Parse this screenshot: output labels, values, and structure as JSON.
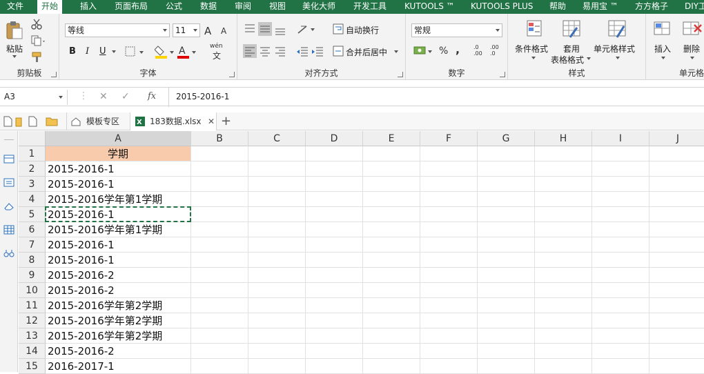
{
  "menu": {
    "tabs": [
      "文件",
      "开始",
      "插入",
      "页面布局",
      "公式",
      "数据",
      "审阅",
      "视图",
      "美化大师",
      "开发工具",
      "KUTOOLS ™",
      "KUTOOLS PLUS",
      "帮助",
      "易用宝 ™",
      "方方格子",
      "DIY工"
    ],
    "active": "开始"
  },
  "ribbon": {
    "clipboard": {
      "label": "剪贴板",
      "paste": "粘贴"
    },
    "font": {
      "label": "字体",
      "name": "等线",
      "size": "11",
      "grow": "A",
      "shrink": "A",
      "bold": "B",
      "italic": "I",
      "underline": "U",
      "wen": "wén",
      "wen_char": "文",
      "font_color_letter": "A"
    },
    "align": {
      "label": "对齐方式",
      "wrap": "自动换行",
      "merge": "合并后居中"
    },
    "number": {
      "label": "数字",
      "format": "常规",
      "percent": "%",
      "comma": ",",
      "inc_dec": ".0\n.00",
      "dec_dec": ".00\n.0"
    },
    "styles": {
      "label": "样式",
      "cond": "条件格式",
      "table_l1": "套用",
      "table_l2": "表格格式",
      "cellstyle": "单元格样式"
    },
    "cells": {
      "label": "单元格",
      "insert": "插入",
      "delete": "删除"
    }
  },
  "formula_bar": {
    "name_box": "A3",
    "fx": "fx",
    "value": "2015-2016-1"
  },
  "doc_tabs": {
    "template": "模板专区",
    "file": "183数据.xlsx",
    "add": "+"
  },
  "grid": {
    "columns": [
      "A",
      "B",
      "C",
      "D",
      "E",
      "F",
      "G",
      "H",
      "I",
      "J"
    ],
    "rows": [
      "1",
      "2",
      "3",
      "4",
      "5",
      "6",
      "7",
      "8",
      "9",
      "10",
      "11",
      "12",
      "13",
      "14",
      "15"
    ],
    "col_a_values": [
      "学期",
      "2015-2016-1",
      "2015-2016-1",
      "2015-2016学年第1学期",
      "2015-2016-1",
      "2015-2016学年第1学期",
      "2015-2016-1",
      "2015-2016-1",
      "2015-2016-2",
      "2015-2016-2",
      "2015-2016学年第2学期",
      "2015-2016学年第2学期",
      "2015-2016学年第2学期",
      "2015-2016-2",
      "2016-2017-1"
    ],
    "header_fill": "#f8cbad",
    "marquee_color": "#217346"
  },
  "colors": {
    "accent": "#217346"
  }
}
